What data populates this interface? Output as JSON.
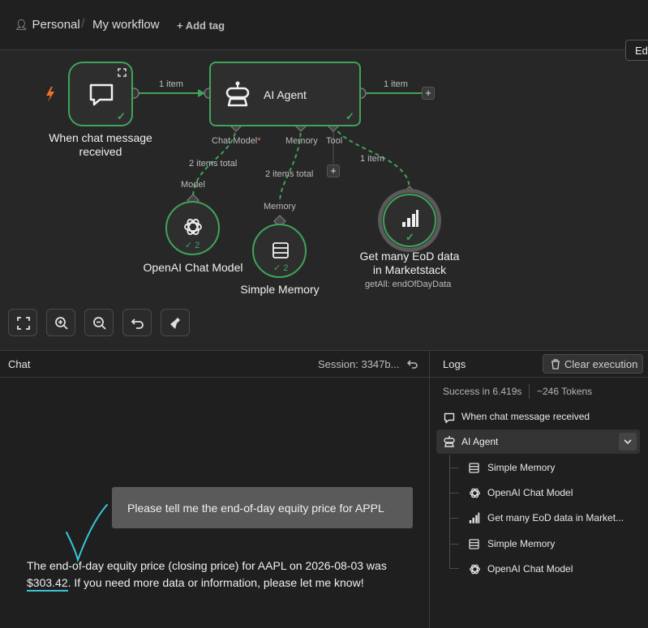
{
  "header": {
    "workspace": "Personal",
    "separator": "/",
    "workflow_name": "My workflow",
    "add_tag": "+ Add tag",
    "edit_tab": "Ed"
  },
  "canvas": {
    "nodes": {
      "trigger": {
        "label": "When chat message received",
        "icon": "chat-bubble-icon"
      },
      "agent": {
        "label": "AI Agent",
        "icon": "robot-icon"
      },
      "openai": {
        "label": "OpenAI Chat Model",
        "count": "2",
        "icon": "openai-icon"
      },
      "memory": {
        "label": "Simple Memory",
        "count": "2",
        "icon": "database-icon"
      },
      "marketstack": {
        "label_line1": "Get many EoD data",
        "label_line2": "in Marketstack",
        "subtitle": "getAll: endOfDayData",
        "icon": "marketstack-icon"
      }
    },
    "wire_labels": {
      "trigger_to_agent": "1 item",
      "agent_out": "1 item",
      "model_total": "2 items total",
      "memory_total": "2 items total",
      "tool_items": "1 item"
    },
    "ports": {
      "chat_model": "Chat Model",
      "chat_model_required": "*",
      "memory": "Memory",
      "tool": "Tool",
      "model": "Model",
      "memory_in": "Memory"
    },
    "plus": "+",
    "toolbar": [
      "fit-view-icon",
      "zoom-in-icon",
      "zoom-out-icon",
      "undo-icon",
      "clean-up-icon"
    ],
    "accent": "#3fa45a"
  },
  "chat": {
    "title": "Chat",
    "session": "Session: 3347b...",
    "user_message": "Please tell me the end-of-day equity price for APPL",
    "reply_part1": "The end-of-day equity price (closing price) for AAPL on 2026-08-03 was ",
    "reply_price": "$303.42",
    "reply_part2": ". If you need more data or information, please let me know!"
  },
  "logs": {
    "title": "Logs",
    "clear_button": "Clear execution",
    "success": "Success in 6.419s",
    "tokens": "~246 Tokens",
    "entries": {
      "trigger": "When chat message received",
      "agent": "AI Agent",
      "children": [
        "Simple Memory",
        "OpenAI Chat Model",
        "Get many EoD data in Market...",
        "Simple Memory",
        "OpenAI Chat Model"
      ]
    }
  }
}
